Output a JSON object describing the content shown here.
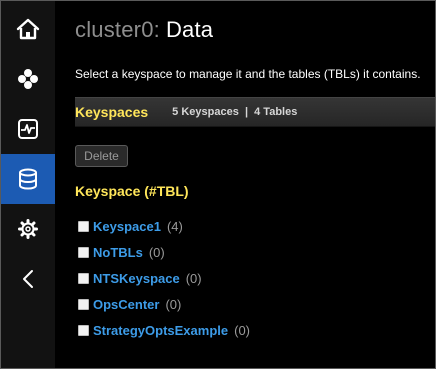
{
  "header": {
    "cluster_label": "cluster0:",
    "page_title": "Data"
  },
  "description": "Select a keyspace to manage it and the tables (TBLs) it contains.",
  "keyspaces_bar": {
    "title": "Keyspaces",
    "stats": "5 Keyspaces  |  4 Tables"
  },
  "delete_button": "Delete",
  "list_header": "Keyspace (#TBL)",
  "keyspaces": [
    {
      "name": "Keyspace1",
      "count": "(4)"
    },
    {
      "name": "NoTBLs",
      "count": "(0)"
    },
    {
      "name": "NTSKeyspace",
      "count": "(0)"
    },
    {
      "name": "OpsCenter",
      "count": "(0)"
    },
    {
      "name": "StrategyOptsExample",
      "count": "(0)"
    }
  ],
  "sidebar": {
    "items": [
      {
        "icon": "home-icon"
      },
      {
        "icon": "cluster-icon"
      },
      {
        "icon": "monitor-icon"
      },
      {
        "icon": "database-icon",
        "active": true
      },
      {
        "icon": "gear-icon"
      },
      {
        "icon": "chevron-left-icon"
      }
    ]
  },
  "colors": {
    "accent_active": "#1c5bb3",
    "highlight_yellow": "#ffe65a",
    "link_blue": "#3d9ce8"
  }
}
